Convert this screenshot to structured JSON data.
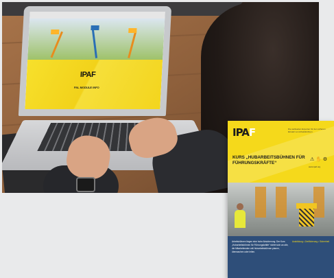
{
  "image": {
    "kind": "marketing-photo",
    "laptop_screen": {
      "logo": "IPAF",
      "title": "PAL MODULE INFO"
    },
    "flyer": {
      "logo_main": "IPA",
      "logo_accent": "F",
      "tagline": "Die weltweiten Experten für den sicheren Einsatz von Arbeitsbühnen",
      "title": "KURS „HUBARBEITSBÜHNEN FÜR FÜHRUNGSKRÄFTE“",
      "icons": "⚠ ✋ ⚙",
      "url": "www.ipaf.org",
      "body_text": "Arbeitsbühnen liegen eine hohe Absicherung. Der Kurs „Hubarbeitsbühnen für Führungskräfte“ richtet sich an alle, die Mitarbeitenden mit Hubarbeitsbühnen planen, überwachen oder leiten.",
      "side_text": "Ausbildung • Zertifizierung • Sicherheit"
    },
    "colors": {
      "ipaf_yellow": "#f5d91b",
      "flyer_blue": "#2e4e79",
      "desk_wood": "#8a5e3c"
    }
  }
}
